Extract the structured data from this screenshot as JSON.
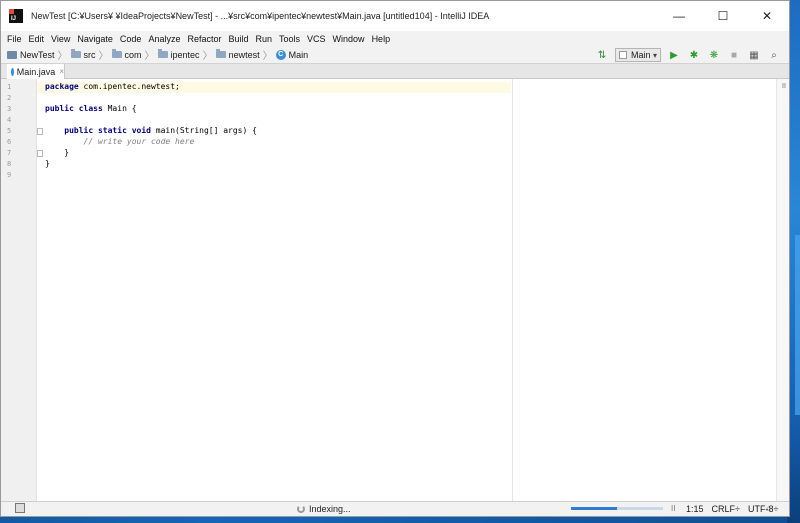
{
  "window": {
    "title": "NewTest [C:¥Users¥                ¥IdeaProjects¥NewTest] - ...¥src¥com¥ipentec¥newtest¥Main.java [untitled104] - IntelliJ IDEA",
    "app_icon_text": "IJ",
    "minimize": "—",
    "maximize": "☐",
    "close": "✕"
  },
  "menu": [
    "File",
    "Edit",
    "View",
    "Navigate",
    "Code",
    "Analyze",
    "Refactor",
    "Build",
    "Run",
    "Tools",
    "VCS",
    "Window",
    "Help"
  ],
  "breadcrumbs": [
    "NewTest",
    "src",
    "com",
    "ipentec",
    "newtest",
    "Main"
  ],
  "toolbar": {
    "run_config": "Main",
    "icons": [
      "sort-icon",
      "run-icon",
      "debug-icon",
      "coverage-icon",
      "stop-icon",
      "project-structure-icon",
      "search-icon"
    ]
  },
  "editor_tab": {
    "label": "Main.java",
    "close": "×"
  },
  "editor": {
    "line_numbers": [
      "1",
      "2",
      "3",
      "4",
      "5",
      "6",
      "7",
      "8",
      "9"
    ],
    "lines": [
      {
        "kw": "package",
        "rest": " com.ipentec.newtest;"
      },
      {
        "kw": "",
        "rest": ""
      },
      {
        "kw": "public class",
        "rest": " Main {"
      },
      {
        "kw": "",
        "rest": ""
      },
      {
        "kw": "    public static void",
        "rest": " main(String[] args) {"
      },
      {
        "cmt": "        // write your code here"
      },
      {
        "kw": "",
        "rest": "    }"
      },
      {
        "kw": "",
        "rest": "}"
      },
      {
        "kw": "",
        "rest": ""
      }
    ]
  },
  "status": {
    "indexing": "Indexing...",
    "progress": 0.5,
    "position": "1:15",
    "line_sep": "CRLF÷",
    "encoding": "UTF-8÷",
    "pause": "II"
  },
  "colors": {
    "accent": "#2e7bd0",
    "keyword": "#000080",
    "comment": "#808080"
  }
}
